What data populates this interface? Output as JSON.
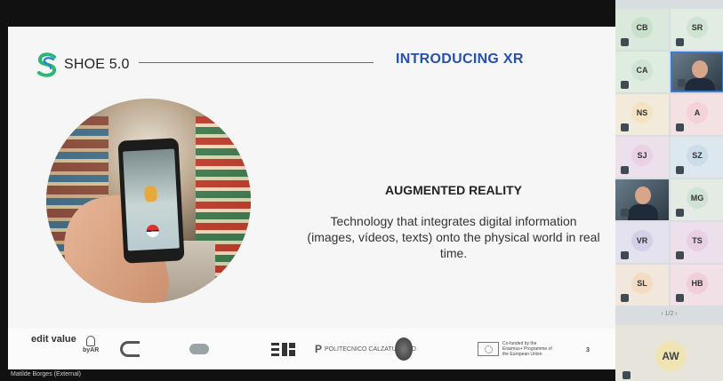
{
  "slide": {
    "brand": "SHOE 5.0",
    "title": "INTRODUCING XR",
    "heading": "AUGMENTED REALITY",
    "body": "Technology that integrates digital information (images, vídeos, texts) onto the physical world in real time.",
    "page_number": "3",
    "accent_color": "#2650b5",
    "footer": {
      "edit_value": "edit value",
      "byar": "byAR",
      "politecnico": "POLITECNICO CALZATURIERO",
      "eu_text": "Co-funded by the Erasmus+ Programme of the European Union"
    }
  },
  "presenter": {
    "name": "Matilde Borges (External)"
  },
  "participants": {
    "tiles": [
      {
        "initials": "CB",
        "bg": "#dbe9dd",
        "av": "#c9e0cb"
      },
      {
        "initials": "SR",
        "bg": "#e1ece2",
        "av": "#cfe5d1"
      },
      {
        "initials": "CA",
        "bg": "#dfece0",
        "av": "#cfe4d1"
      },
      {
        "initials": "",
        "video": true
      },
      {
        "initials": "NS",
        "bg": "#f2eadb",
        "av": "#f4e3c0"
      },
      {
        "initials": "A",
        "bg": "#f3e1e4",
        "av": "#f4d3d8"
      },
      {
        "initials": "SJ",
        "bg": "#ece1ea",
        "av": "#ead2e5"
      },
      {
        "initials": "SZ",
        "bg": "#dde7ee",
        "av": "#cbdde9"
      },
      {
        "initials": "",
        "video": true
      },
      {
        "initials": "MG",
        "bg": "#e3ebe4",
        "av": "#d1e3d4"
      },
      {
        "initials": "VR",
        "bg": "#e4e2ef",
        "av": "#d3d0ea"
      },
      {
        "initials": "TS",
        "bg": "#ece1ea",
        "av": "#e6d0e2"
      },
      {
        "initials": "SL",
        "bg": "#f2e7dc",
        "av": "#f3dcc3"
      },
      {
        "initials": "HB",
        "bg": "#f1e1e6",
        "av": "#efd0da"
      }
    ],
    "pagination": "‹  1/2  ›",
    "bottom": {
      "initials": "AW"
    }
  }
}
